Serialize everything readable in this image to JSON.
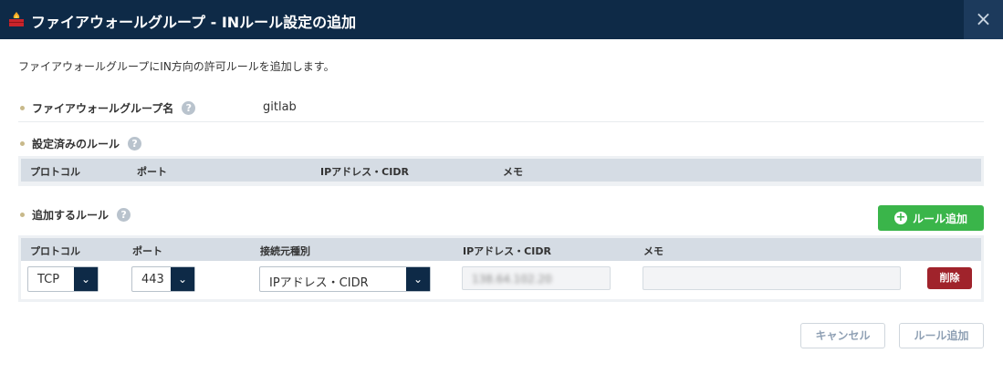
{
  "window": {
    "title": "ファイアウォールグループ - INルール設定の追加",
    "close_glyph": "×",
    "icon": "firewall-icon"
  },
  "description": "ファイアウォールグループにIN方向の許可ルールを追加します。",
  "firewall_group": {
    "label": "ファイアウォールグループ名",
    "value": "gitlab"
  },
  "existing_rules": {
    "label": "設定済みのルール",
    "columns": [
      "プロトコル",
      "ポート",
      "IPアドレス・CIDR",
      "メモ"
    ]
  },
  "new_rules": {
    "label": "追加するルール",
    "add_button": "ルール追加",
    "columns": [
      "プロトコル",
      "ポート",
      "接続元種別",
      "IPアドレス・CIDR",
      "メモ"
    ],
    "row": {
      "protocol": "TCP",
      "port": "443",
      "source_type": "IPアドレス・CIDR",
      "ip_cidr": "138.64.102.20",
      "memo": "",
      "delete_label": "削除"
    }
  },
  "footer": {
    "cancel": "キャンセル",
    "submit": "ルール追加"
  },
  "help_glyph": "?",
  "colors": {
    "header_bg": "#0e2a47",
    "add_green": "#3ab54a",
    "delete_red": "#a0232b",
    "table_head": "#d5dce4"
  }
}
